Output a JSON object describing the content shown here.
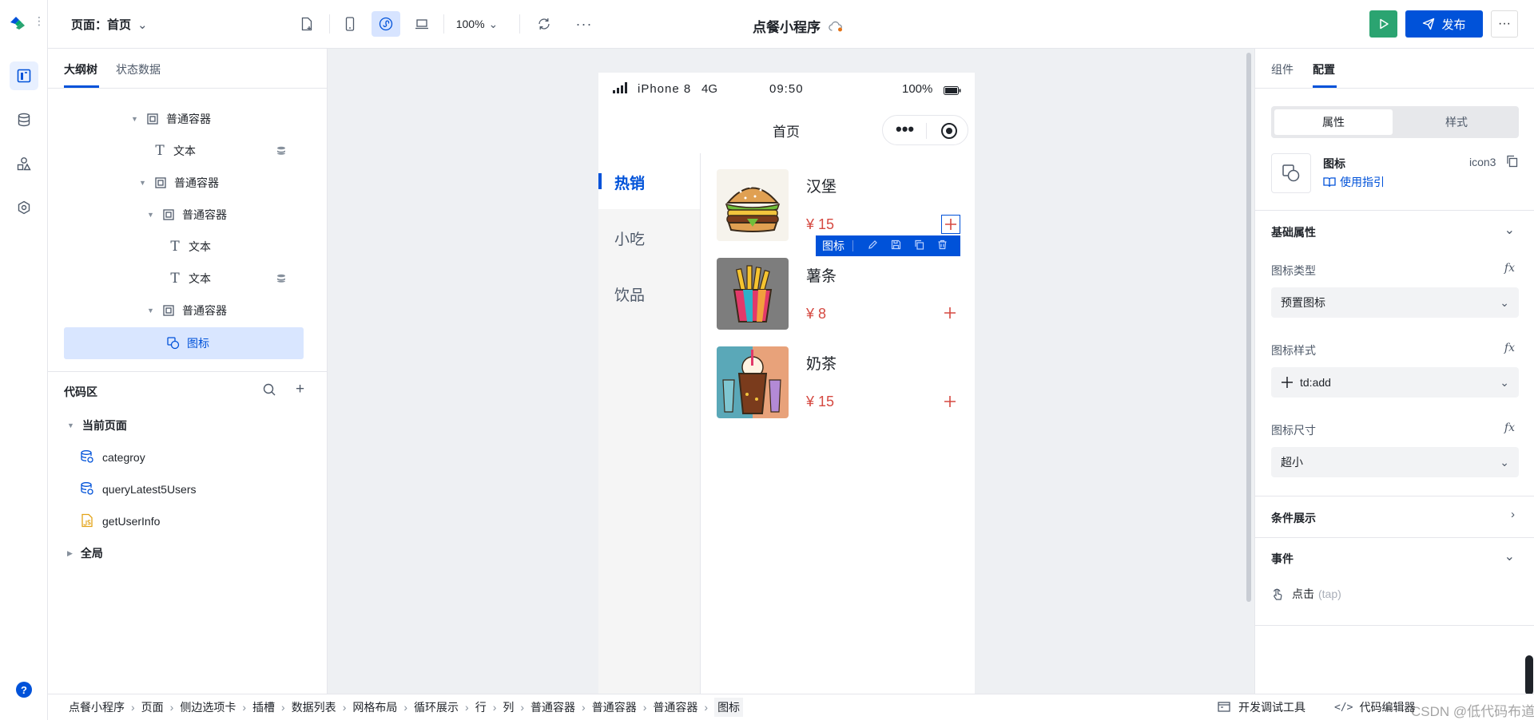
{
  "topbar": {
    "page_label": "页面：首页",
    "zoom": "100%",
    "app_title": "点餐小程序",
    "publish_label": "发布"
  },
  "left": {
    "tabs": [
      "大纲树",
      "状态数据"
    ],
    "tree": [
      {
        "label": "普通容器",
        "type": "container"
      },
      {
        "label": "文本",
        "type": "text"
      },
      {
        "label": "普通容器",
        "type": "container"
      },
      {
        "label": "普通容器",
        "type": "container"
      },
      {
        "label": "文本",
        "type": "text"
      },
      {
        "label": "文本",
        "type": "text"
      },
      {
        "label": "普通容器",
        "type": "container"
      },
      {
        "label": "图标",
        "type": "icon"
      }
    ],
    "code_title": "代码区",
    "current_page": "当前页面",
    "code_items": [
      "categroy",
      "queryLatest5Users",
      "getUserInfo"
    ],
    "global": "全局"
  },
  "phone": {
    "device": "iPhone 8",
    "network": "4G",
    "time": "09:50",
    "battery": "100%",
    "nav_title": "首页",
    "categories": [
      "热销",
      "小吃",
      "饮品"
    ],
    "products": [
      {
        "name": "汉堡",
        "price": "¥ 15"
      },
      {
        "name": "薯条",
        "price": "¥ 8"
      },
      {
        "name": "奶茶",
        "price": "¥ 15"
      }
    ],
    "selection_label": "图标"
  },
  "right": {
    "tabs": [
      "组件",
      "配置"
    ],
    "seg": [
      "属性",
      "样式"
    ],
    "component_name": "图标",
    "component_id": "icon3",
    "guide": "使用指引",
    "basic_title": "基础属性",
    "icon_type_label": "图标类型",
    "icon_type_value": "预置图标",
    "icon_style_label": "图标样式",
    "icon_style_value": "td:add",
    "icon_size_label": "图标尺寸",
    "icon_size_value": "超小",
    "cond_title": "条件展示",
    "event_title": "事件",
    "event_item": "点击",
    "event_sub": "(tap)",
    "fx": "fx"
  },
  "bottom": {
    "crumbs": [
      "点餐小程序",
      "页面",
      "侧边选项卡",
      "插槽",
      "数据列表",
      "网格布局",
      "循环展示",
      "行",
      "列",
      "普通容器",
      "普通容器",
      "普通容器",
      "图标"
    ],
    "debug": "开发调试工具",
    "code_editor": "代码编辑器",
    "watermark": "CSDN @低代码布道师"
  },
  "colors": {
    "brand": "#0052d9",
    "price": "#d54941",
    "run": "#2ba471"
  }
}
